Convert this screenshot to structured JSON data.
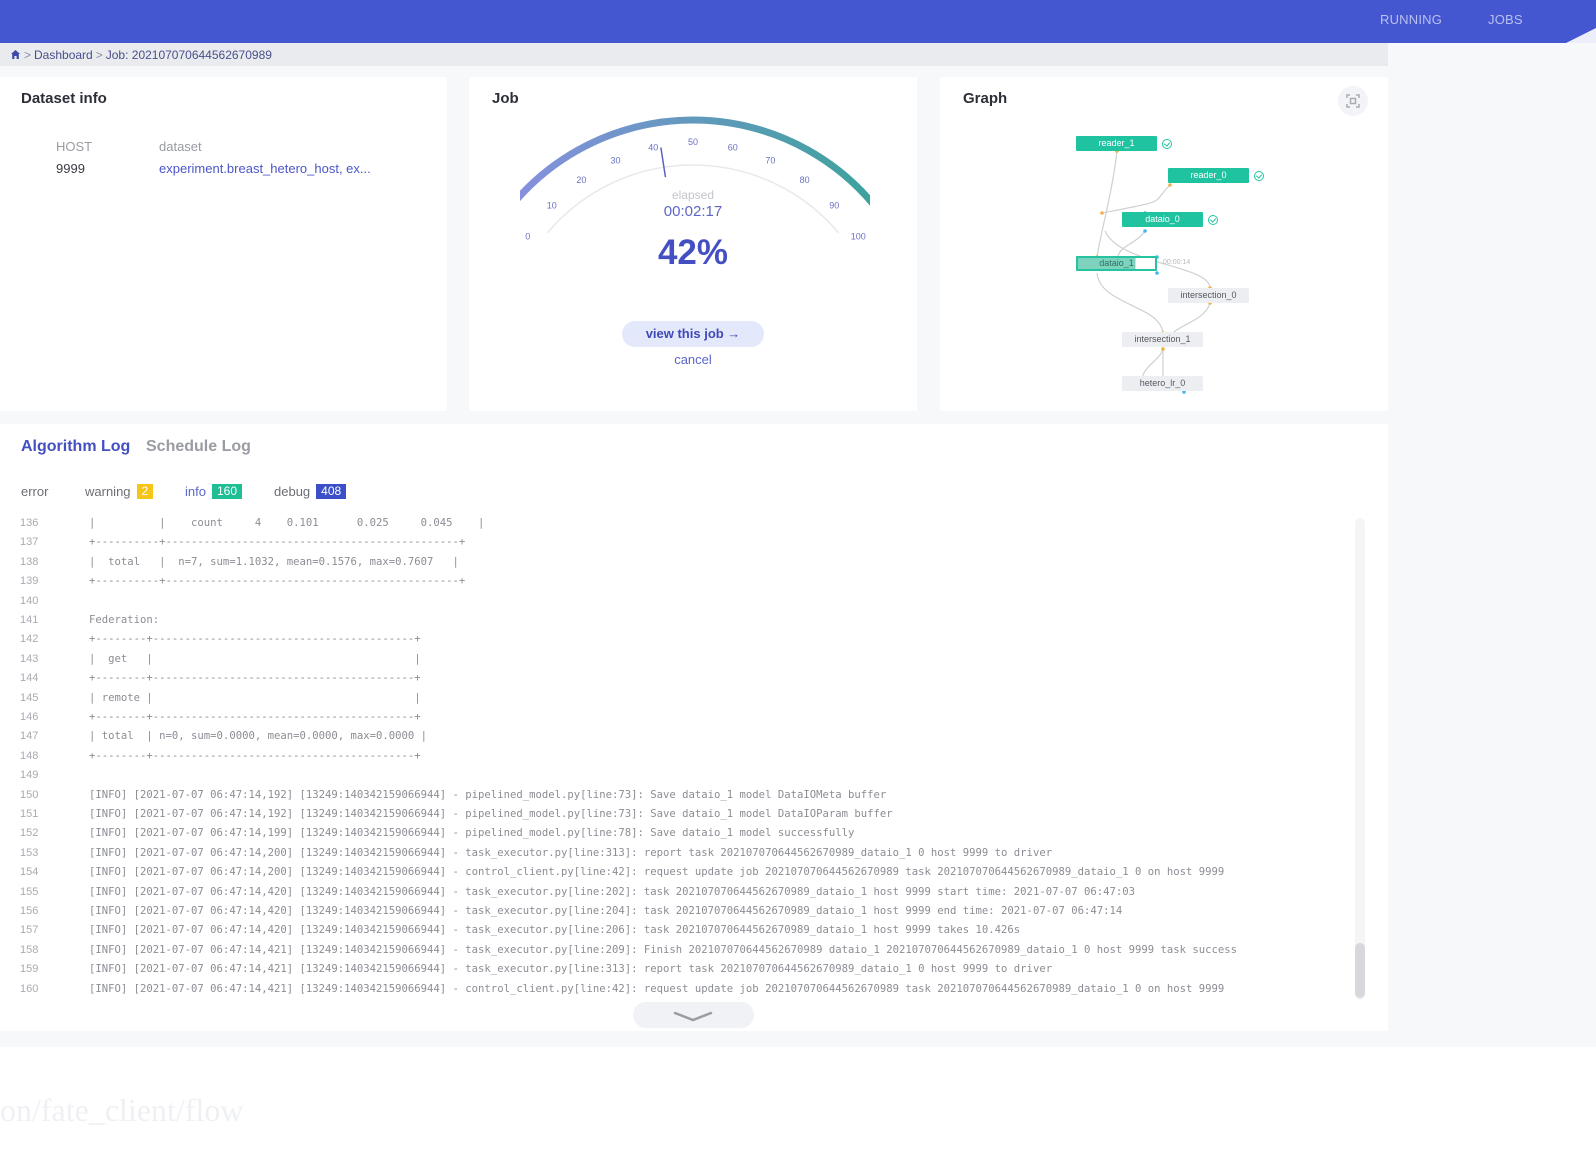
{
  "nav": {
    "items": [
      {
        "label": "RUNNING"
      },
      {
        "label": "JOBS"
      }
    ]
  },
  "breadcrumb": {
    "home_icon": "home-icon",
    "separator": ">",
    "items": [
      {
        "label": "Dashboard"
      },
      {
        "label": "Job: 202107070644562670989"
      }
    ]
  },
  "dataset_info": {
    "title": "Dataset info",
    "role_label": "HOST",
    "role_value": "9999",
    "dataset_label": "dataset",
    "dataset_value": "experiment.breast_hetero_host, ex..."
  },
  "job": {
    "title": "Job",
    "gauge": {
      "min": 0,
      "max": 100,
      "ticks": [
        "0",
        "10",
        "20",
        "30",
        "40",
        "50",
        "60",
        "70",
        "80",
        "90",
        "100"
      ],
      "value": 42,
      "colors": {
        "start": "#8a8fe0",
        "end": "#3aa39a"
      }
    },
    "elapsed_label": "elapsed",
    "elapsed_value": "00:02:17",
    "progress_text": "42%",
    "view_button": "view this job →",
    "cancel_link": "cancel"
  },
  "graph": {
    "title": "Graph",
    "fullscreen_icon": "fullscreen-icon",
    "nodes": [
      {
        "label": "reader_1",
        "status": "success"
      },
      {
        "label": "reader_0",
        "status": "success"
      },
      {
        "label": "dataio_0",
        "status": "success"
      },
      {
        "label": "dataio_1",
        "status": "running",
        "time": "00:00:14"
      },
      {
        "label": "intersection_0",
        "status": "waiting"
      },
      {
        "label": "intersection_1",
        "status": "waiting"
      },
      {
        "label": "hetero_lr_0",
        "status": "waiting"
      }
    ]
  },
  "logs": {
    "tabs": [
      {
        "label": "Algorithm Log",
        "active": true
      },
      {
        "label": "Schedule Log",
        "active": false
      }
    ],
    "filters": [
      {
        "label": "error",
        "count": null
      },
      {
        "label": "warning",
        "count": "2",
        "color": "#f5c518"
      },
      {
        "label": "info",
        "count": "160",
        "color": "#1fbf95"
      },
      {
        "label": "debug",
        "count": "408",
        "color": "#3b4fc9"
      }
    ],
    "lines": [
      {
        "n": "136",
        "t": "|          |    count     4    0.101      0.025     0.045    |"
      },
      {
        "n": "137",
        "t": "+----------+----------------------------------------------+"
      },
      {
        "n": "138",
        "t": "|  total   |  n=7, sum=1.1032, mean=0.1576, max=0.7607   |"
      },
      {
        "n": "139",
        "t": "+----------+----------------------------------------------+"
      },
      {
        "n": "140",
        "t": ""
      },
      {
        "n": "141",
        "t": "Federation:"
      },
      {
        "n": "142",
        "t": "+--------+-----------------------------------------+"
      },
      {
        "n": "143",
        "t": "|  get   |                                         |"
      },
      {
        "n": "144",
        "t": "+--------+-----------------------------------------+"
      },
      {
        "n": "145",
        "t": "| remote |                                         |"
      },
      {
        "n": "146",
        "t": "+--------+-----------------------------------------+"
      },
      {
        "n": "147",
        "t": "| total  | n=0, sum=0.0000, mean=0.0000, max=0.0000 |"
      },
      {
        "n": "148",
        "t": "+--------+-----------------------------------------+"
      },
      {
        "n": "149",
        "t": ""
      },
      {
        "n": "150",
        "t": "[INFO] [2021-07-07 06:47:14,192] [13249:140342159066944] - pipelined_model.py[line:73]: Save dataio_1 model DataIOMeta buffer"
      },
      {
        "n": "151",
        "t": "[INFO] [2021-07-07 06:47:14,192] [13249:140342159066944] - pipelined_model.py[line:73]: Save dataio_1 model DataIOParam buffer"
      },
      {
        "n": "152",
        "t": "[INFO] [2021-07-07 06:47:14,199] [13249:140342159066944] - pipelined_model.py[line:78]: Save dataio_1 model successfully"
      },
      {
        "n": "153",
        "t": "[INFO] [2021-07-07 06:47:14,200] [13249:140342159066944] - task_executor.py[line:313]: report task 202107070644562670989_dataio_1 0 host 9999 to driver"
      },
      {
        "n": "154",
        "t": "[INFO] [2021-07-07 06:47:14,200] [13249:140342159066944] - control_client.py[line:42]: request update job 202107070644562670989 task 202107070644562670989_dataio_1 0 on host 9999"
      },
      {
        "n": "155",
        "t": "[INFO] [2021-07-07 06:47:14,420] [13249:140342159066944] - task_executor.py[line:202]: task 202107070644562670989_dataio_1 host 9999 start time: 2021-07-07 06:47:03"
      },
      {
        "n": "156",
        "t": "[INFO] [2021-07-07 06:47:14,420] [13249:140342159066944] - task_executor.py[line:204]: task 202107070644562670989_dataio_1 host 9999 end time: 2021-07-07 06:47:14"
      },
      {
        "n": "157",
        "t": "[INFO] [2021-07-07 06:47:14,420] [13249:140342159066944] - task_executor.py[line:206]: task 202107070644562670989_dataio_1 host 9999 takes 10.426s"
      },
      {
        "n": "158",
        "t": "[INFO] [2021-07-07 06:47:14,421] [13249:140342159066944] - task_executor.py[line:209]: Finish 202107070644562670989 dataio_1 202107070644562670989_dataio_1 0 host 9999 task success"
      },
      {
        "n": "159",
        "t": "[INFO] [2021-07-07 06:47:14,421] [13249:140342159066944] - task_executor.py[line:313]: report task 202107070644562670989_dataio_1 0 host 9999 to driver"
      },
      {
        "n": "160",
        "t": "[INFO] [2021-07-07 06:47:14,421] [13249:140342159066944] - control_client.py[line:42]: request update job 202107070644562670989 task 202107070644562670989_dataio_1 0 on host 9999"
      }
    ],
    "scroll_down_icon": "chevron-down-icon"
  },
  "background_text": "on/fate_client/flow"
}
